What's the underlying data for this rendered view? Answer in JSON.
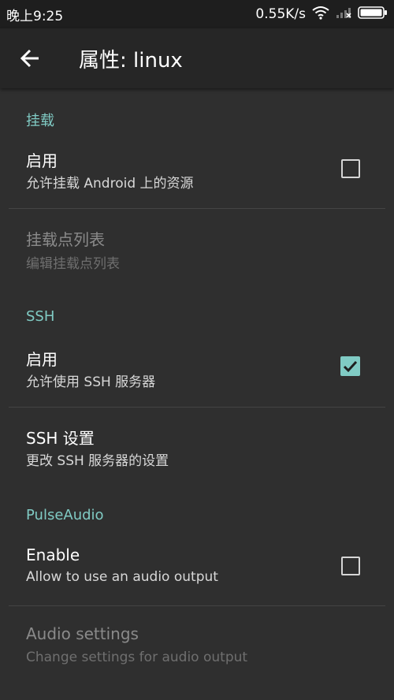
{
  "status_bar": {
    "time": "晚上9:25",
    "speed": "0.55K/s"
  },
  "app_bar": {
    "title": "属性: linux"
  },
  "sections": {
    "mount": {
      "header": "挂载",
      "enable_title": "启用",
      "enable_summary": "允许挂载 Android 上的资源",
      "enable_checked": false,
      "mountpoints_title": "挂载点列表",
      "mountpoints_summary": "编辑挂载点列表"
    },
    "ssh": {
      "header": "SSH",
      "enable_title": "启用",
      "enable_summary": "允许使用 SSH 服务器",
      "enable_checked": true,
      "settings_title": "SSH 设置",
      "settings_summary": "更改 SSH 服务器的设置"
    },
    "pulse": {
      "header": "PulseAudio",
      "enable_title": "Enable",
      "enable_summary": "Allow to use an audio output",
      "enable_checked": false,
      "settings_title": "Audio settings",
      "settings_summary": "Change settings for audio output"
    }
  },
  "colors": {
    "accent": "#80cbc4",
    "background": "#2f2f2f",
    "app_bar": "#262626"
  }
}
